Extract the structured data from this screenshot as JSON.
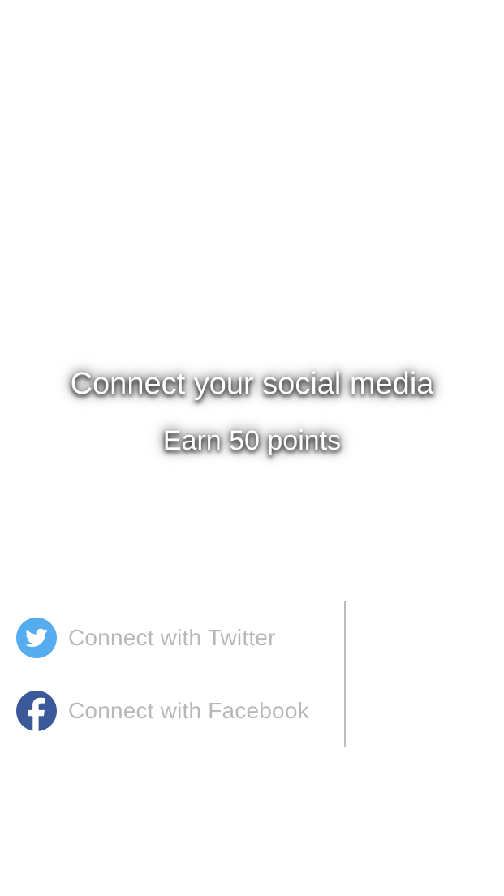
{
  "hero": {
    "title": "Connect your social media",
    "subtitle": "Earn 50 points"
  },
  "social": {
    "twitter": {
      "label": "Connect with Twitter",
      "icon": "twitter-icon",
      "color": "#55acee"
    },
    "facebook": {
      "label": "Connect with Facebook",
      "icon": "facebook-icon",
      "color": "#3b5998"
    }
  },
  "colors": {
    "background": "#ffffff",
    "label_text": "#b8b8b8",
    "divider": "#cfcfcf"
  }
}
